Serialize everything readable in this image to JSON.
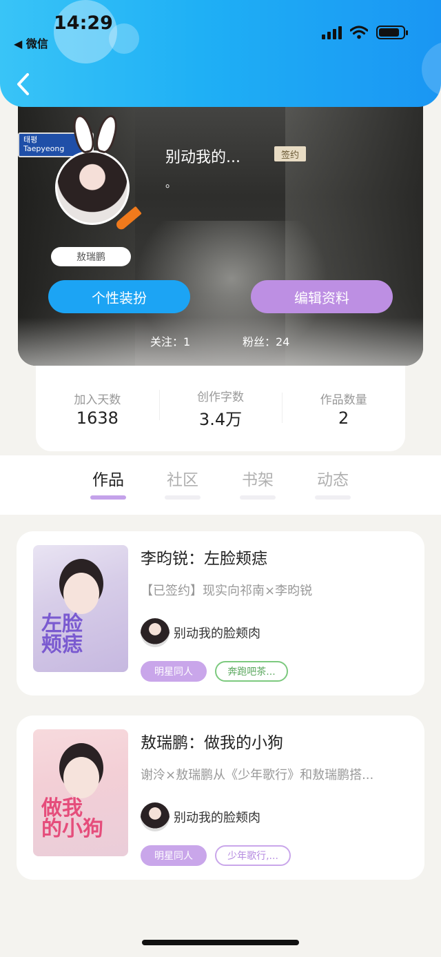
{
  "status_bar": {
    "time": "14:29",
    "back_app": "◀ 微信"
  },
  "profile": {
    "street_sign": "태평\nTaepyeong",
    "nickname": "别动我的...",
    "badge": "签约",
    "bio": "。",
    "avatar_label": "敖瑞鹏",
    "outfit_button": "个性装扮",
    "edit_button": "编辑资料",
    "following": "关注：1",
    "followers": "粉丝：24"
  },
  "stats": [
    {
      "label": "加入天数",
      "value": "1638"
    },
    {
      "label": "创作字数",
      "value": "3.4万"
    },
    {
      "label": "作品数量",
      "value": "2"
    }
  ],
  "tabs": [
    {
      "label": "作品",
      "active": true
    },
    {
      "label": "社区",
      "active": false
    },
    {
      "label": "书架",
      "active": false
    },
    {
      "label": "动态",
      "active": false
    }
  ],
  "works": [
    {
      "cover_text": "左脸\n颊痣",
      "title": "李昀锐：左脸颊痣",
      "description": "【已签约】现实向祁南×李昀锐",
      "author": "别动我的脸颊肉",
      "tags": [
        "明星同人",
        "奔跑吧茶..."
      ]
    },
    {
      "cover_text": "做我\n的小狗",
      "title": "敖瑞鹏：做我的小狗",
      "description": "谢泠×敖瑞鹏从《少年歌行》和敖瑞鹏搭...",
      "author": "别动我的脸颊肉",
      "tags": [
        "明星同人",
        "少年歌行,..."
      ]
    }
  ],
  "colors": {
    "header_blue": "#1fb0f5",
    "accent_purple": "#bd8fe3",
    "button_blue": "#1ca4f4"
  }
}
